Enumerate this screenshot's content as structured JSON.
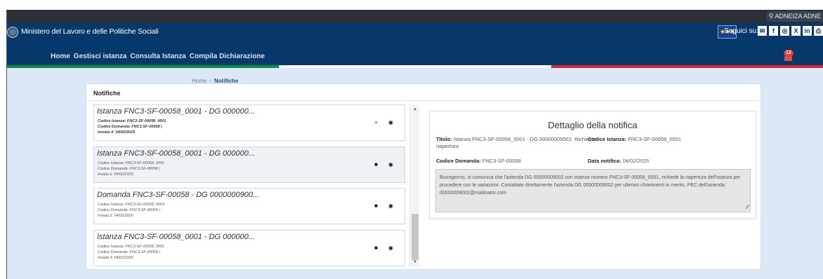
{
  "colors": {
    "brand": "#06386b",
    "background": "#dce8f5",
    "italy_green": "#009246",
    "italy_red": "#ce2b37"
  },
  "topbar": {
    "login_label": "ADNEIZA ADNE",
    "languages": [
      {
        "code": "it",
        "icon": "italian-flag"
      },
      {
        "code": "de",
        "icon": "german-flag"
      }
    ]
  },
  "header": {
    "ministry_name": "Ministero del Lavoro e delle Politiche Sociali",
    "follow_label": "Seguici su:",
    "social": [
      {
        "name": "email",
        "glyph": "✉"
      },
      {
        "name": "facebook",
        "glyph": "f"
      },
      {
        "name": "instagram",
        "glyph": "◎"
      },
      {
        "name": "x",
        "glyph": "X"
      },
      {
        "name": "linkedin",
        "glyph": "in"
      },
      {
        "name": "print",
        "glyph": "⎙"
      }
    ],
    "nav": [
      "Home",
      "Gestisci istanza",
      "Consulta Istanza",
      "Compila Dichiarazione"
    ],
    "notifications_count": "12"
  },
  "breadcrumb": {
    "home": "Home",
    "separator": "›",
    "current": "Notifiche"
  },
  "notifications": {
    "title": "Notifiche",
    "items": [
      {
        "title": "Istanza FNC3-SF-00058_0001 - DG 000000...",
        "codice_istanza": "Codice Istanza: FNC3-SF-00058_0001",
        "codice_domanda": "Codice Domanda: FNC3-SF-00058 |",
        "inviato": "Inviato il: 04/02/2025"
      },
      {
        "title": "Istanza FNC3-SF-00058_0001 - DG 000000...",
        "codice_istanza": "Codice Istanza: FNC3-SF-00058_0001",
        "codice_domanda": "Codice Domanda: FNC3-SF-00058 |",
        "inviato": "Inviato il: 04/02/2025"
      },
      {
        "title": "Domanda FNC3-SF-00058 - DG 0000000900...",
        "codice_istanza": "Codice Istanza: FNC3-SF-00058_0003",
        "codice_domanda": "Codice Domanda: FNC3-SF-00058 |",
        "inviato": "Inviato il: 04/02/2025"
      },
      {
        "title": "Istanza FNC3-SF-00058_0001 - DG 000000...",
        "codice_istanza": "Codice Istanza: FNC3-SF-00058_0001",
        "codice_domanda": "Codice Domanda: FNC3-SF-00058 |",
        "inviato": "Inviato il: 04/02/2025"
      }
    ]
  },
  "detail": {
    "heading": "Dettaglio della notifica",
    "titolo_label": "Titolo:",
    "titolo_value": "Istanza FNC3-SF-00058_0001 - DG 00000009002: Richiesta riapertura",
    "codice_istanza_label": "Codice Istanza:",
    "codice_istanza_value": "FNC3-SF-00058_0001",
    "codice_domanda_label": "Codice Domanda:",
    "codice_domanda_value": "FNC3-SF-00058",
    "data_label": "Data notifica:",
    "data_value": "04/02/2025",
    "message": "Buongiorno, si comunica che l'azienda DG 00000009002 con istanza numero FNC3-SF-00058_0001, richiede la riapertura dell'istanza per procedere con le variazioni. Contattate direttamente l'azienda DG 00000009002 per ulteriori chiarimenti in merito, PEC dell'azienda: 00000009002@mailinator.com"
  }
}
